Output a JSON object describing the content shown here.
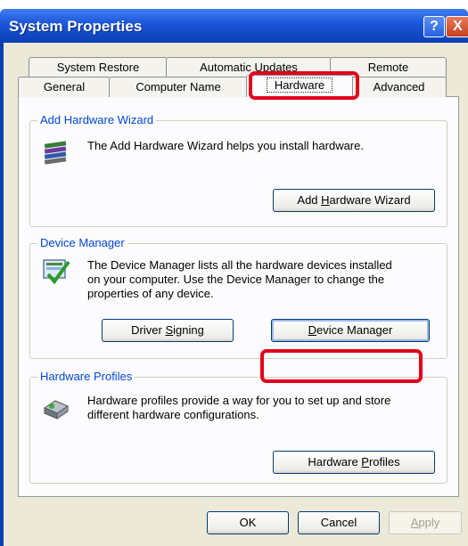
{
  "window": {
    "title": "System Properties",
    "help_glyph": "?",
    "close_glyph": "X"
  },
  "tabs": {
    "back_row": [
      "System Restore",
      "Automatic Updates",
      "Remote"
    ],
    "front_row": [
      "General",
      "Computer Name",
      "Hardware",
      "Advanced"
    ],
    "active": "Hardware"
  },
  "add_hardware": {
    "title": "Add Hardware Wizard",
    "description": "The Add Hardware Wizard helps you install hardware.",
    "button_pre": "Add ",
    "button_accel": "H",
    "button_post": "ardware Wizard",
    "icon": "add-hardware-wizard-icon"
  },
  "device_manager": {
    "title": "Device Manager",
    "description_lines": [
      "The Device Manager lists all the hardware devices installed",
      "on your computer. Use the Device Manager to change the",
      "properties of any device."
    ],
    "driver_pre": "Driver ",
    "driver_accel": "S",
    "driver_post": "igning",
    "dm_accel": "D",
    "dm_post": "evice Manager",
    "icon": "device-manager-icon"
  },
  "hardware_profiles": {
    "title": "Hardware Profiles",
    "description_lines": [
      "Hardware profiles provide a way for you to set up and store",
      "different hardware configurations."
    ],
    "button_pre": "Hardware ",
    "button_accel": "P",
    "button_post": "rofiles",
    "icon": "hardware-profiles-icon"
  },
  "footer": {
    "ok": "OK",
    "cancel": "Cancel",
    "apply_accel": "A",
    "apply_post": "pply"
  },
  "colors": {
    "highlight": "#e3001b",
    "group_title": "#0046d5",
    "title_bar": "#0a3fb4"
  }
}
